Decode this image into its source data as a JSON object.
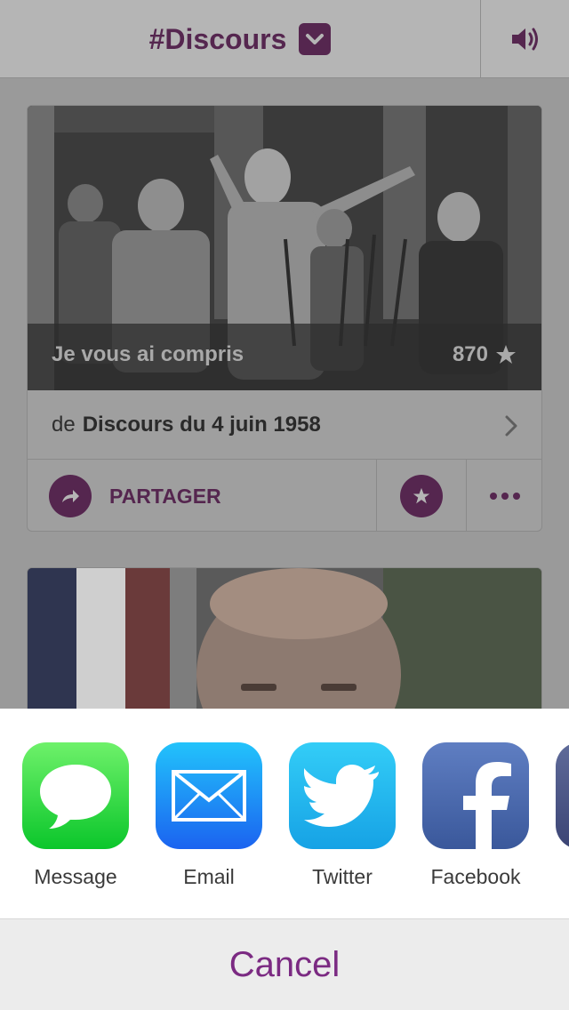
{
  "header": {
    "title": "#Discours",
    "dropdown_icon": "chevron-down-icon",
    "sound_icon": "speaker-icon"
  },
  "feed": {
    "cards": [
      {
        "caption": "Je vous ai compris",
        "count": "870",
        "source_prefix": "de",
        "source": "Discours du 4 juin 1958",
        "share_label": "PARTAGER"
      }
    ]
  },
  "share_sheet": {
    "apps": [
      {
        "label": "Message",
        "icon": "message-bubble-icon"
      },
      {
        "label": "Email",
        "icon": "envelope-icon"
      },
      {
        "label": "Twitter",
        "icon": "twitter-bird-icon"
      },
      {
        "label": "Facebook",
        "icon": "facebook-f-icon"
      }
    ],
    "cancel_label": "Cancel"
  },
  "colors": {
    "accent": "#55264f",
    "cancel": "#7b2a82",
    "dim_background": "#9a9a9a"
  }
}
